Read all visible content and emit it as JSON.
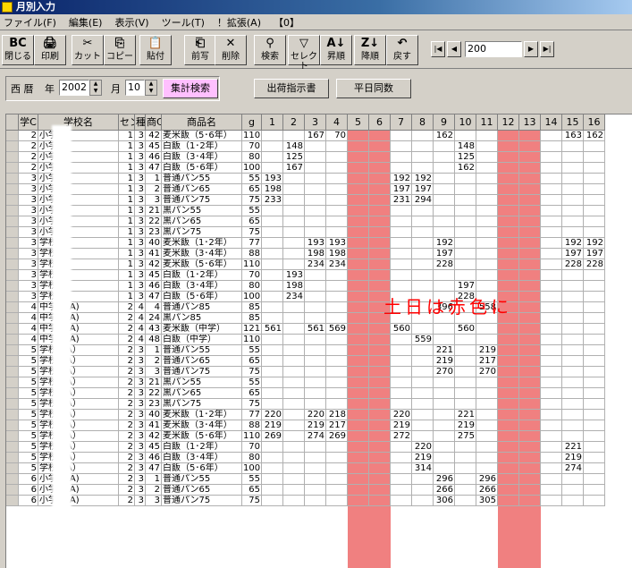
{
  "window": {
    "title": "月別入力"
  },
  "menu": [
    "ファイル(F)",
    "編集(E)",
    "表示(V)",
    "ツール(T)",
    "！拡張(A)",
    "【0】"
  ],
  "toolbar": {
    "buttons": [
      {
        "label": "閉じる",
        "icon": "close-app-icon",
        "glyph": "BC"
      },
      {
        "label": "印刷",
        "icon": "print-icon",
        "glyph": "🖨"
      },
      {
        "label": "カット",
        "icon": "cut-icon",
        "glyph": "✂"
      },
      {
        "label": "コピー",
        "icon": "copy-icon",
        "glyph": "⎘"
      },
      {
        "label": "貼付",
        "icon": "paste-icon",
        "glyph": "📋"
      },
      {
        "label": "前写",
        "icon": "copy-previous-icon",
        "glyph": "⎗"
      },
      {
        "label": "削除",
        "icon": "delete-icon",
        "glyph": "✕"
      },
      {
        "label": "検索",
        "icon": "binoculars-icon",
        "glyph": "⚲"
      },
      {
        "label": "セレクト",
        "icon": "filter-icon",
        "glyph": "▽"
      },
      {
        "label": "昇順",
        "icon": "sort-asc-icon",
        "glyph": "A↓"
      },
      {
        "label": "降順",
        "icon": "sort-desc-icon",
        "glyph": "Z↓"
      },
      {
        "label": "戻す",
        "icon": "undo-icon",
        "glyph": "↶"
      }
    ],
    "record_value": "200"
  },
  "filter": {
    "era_label": "西 暦",
    "year_label": "年",
    "year_value": "2002",
    "month_label": "月",
    "month_value": "10",
    "search_button": "集計検索",
    "shipping_button": "出荷指示書",
    "weekday_button": "平日同数"
  },
  "overlay_text": "土日は赤色に",
  "colors": {
    "weekend": "#f08080",
    "search_button_bg": "#ffc0ff",
    "annotation": "#ff0000"
  },
  "grid": {
    "headers": [
      "学C",
      "学校名",
      "センC",
      "種",
      "商C",
      "商品名",
      "g",
      "1",
      "2",
      "3",
      "4",
      "5",
      "6",
      "7",
      "8",
      "9",
      "10",
      "11",
      "12",
      "13",
      "14",
      "15",
      "16"
    ],
    "rows": [
      [
        "2",
        "小学校",
        "1",
        "3",
        "42",
        "麦米飯（5･6年）",
        "110",
        "",
        "",
        "167",
        "70",
        "",
        "",
        "",
        "",
        "162",
        "",
        "",
        "",
        "",
        "",
        "163",
        "162"
      ],
      [
        "2",
        "小学校",
        "1",
        "3",
        "45",
        "白飯（1･2年）",
        "70",
        "",
        "148",
        "",
        "",
        "",
        "",
        "",
        "",
        "",
        "148",
        "",
        "",
        "",
        "",
        "",
        ""
      ],
      [
        "2",
        "小学校",
        "1",
        "3",
        "46",
        "白飯（3･4年）",
        "80",
        "",
        "125",
        "",
        "",
        "",
        "",
        "",
        "",
        "",
        "125",
        "",
        "",
        "",
        "",
        "",
        ""
      ],
      [
        "2",
        "小学校",
        "1",
        "3",
        "47",
        "白飯（5･6年）",
        "100",
        "",
        "167",
        "",
        "",
        "",
        "",
        "",
        "",
        "",
        "162",
        "",
        "",
        "",
        "",
        "",
        ""
      ],
      [
        "3",
        "小学校",
        "1",
        "3",
        "1",
        "普通パン55",
        "55",
        "193",
        "",
        "",
        "",
        "",
        "",
        "192",
        "192",
        "",
        "",
        "",
        "",
        "",
        "",
        "",
        ""
      ],
      [
        "3",
        "小学校",
        "1",
        "3",
        "2",
        "普通パン65",
        "65",
        "198",
        "",
        "",
        "",
        "",
        "",
        "197",
        "197",
        "",
        "",
        "",
        "",
        "",
        "",
        "",
        ""
      ],
      [
        "3",
        "小学校",
        "1",
        "3",
        "3",
        "普通パン75",
        "75",
        "233",
        "",
        "",
        "",
        "",
        "",
        "231",
        "294",
        "",
        "",
        "",
        "",
        "",
        "",
        "",
        ""
      ],
      [
        "3",
        "小学校",
        "1",
        "3",
        "21",
        "黒パン55",
        "55",
        "",
        "",
        "",
        "",
        "",
        "",
        "",
        "",
        "",
        "",
        "",
        "",
        "",
        "",
        "",
        ""
      ],
      [
        "3",
        "小学校",
        "1",
        "3",
        "22",
        "黒パン65",
        "65",
        "",
        "",
        "",
        "",
        "",
        "",
        "",
        "",
        "",
        "",
        "",
        "",
        "",
        "",
        "",
        ""
      ],
      [
        "3",
        "小学校",
        "1",
        "3",
        "23",
        "黒パン75",
        "75",
        "",
        "",
        "",
        "",
        "",
        "",
        "",
        "",
        "",
        "",
        "",
        "",
        "",
        "",
        "",
        ""
      ],
      [
        "3",
        "学校",
        "1",
        "3",
        "40",
        "麦米飯（1･2年）",
        "77",
        "",
        "",
        "193",
        "193",
        "",
        "",
        "",
        "",
        "192",
        "",
        "",
        "",
        "",
        "",
        "192",
        "192"
      ],
      [
        "3",
        "学校",
        "1",
        "3",
        "41",
        "麦米飯（3･4年）",
        "88",
        "",
        "",
        "198",
        "198",
        "",
        "",
        "",
        "",
        "197",
        "",
        "",
        "",
        "",
        "",
        "197",
        "197"
      ],
      [
        "3",
        "学校",
        "1",
        "3",
        "42",
        "麦米飯（5･6年）",
        "110",
        "",
        "",
        "234",
        "234",
        "",
        "",
        "",
        "",
        "228",
        "",
        "",
        "",
        "",
        "",
        "228",
        "228"
      ],
      [
        "3",
        "学校",
        "1",
        "3",
        "45",
        "白飯（1･2年）",
        "70",
        "",
        "193",
        "",
        "",
        "",
        "",
        "",
        "",
        "",
        "",
        "",
        "",
        "",
        "",
        "",
        ""
      ],
      [
        "3",
        "学校",
        "1",
        "3",
        "46",
        "白飯（3･4年）",
        "80",
        "",
        "198",
        "",
        "",
        "",
        "",
        "",
        "",
        "",
        "197",
        "",
        "",
        "",
        "",
        "",
        ""
      ],
      [
        "3",
        "学校",
        "1",
        "3",
        "47",
        "白飯（5･6年）",
        "100",
        "",
        "234",
        "",
        "",
        "",
        "",
        "",
        "",
        "",
        "228",
        "",
        "",
        "",
        "",
        "",
        ""
      ],
      [
        "4",
        "中学校(A)",
        "2",
        "4",
        "4",
        "普通パン85",
        "85",
        "",
        "",
        "",
        "",
        "",
        "",
        "",
        "",
        "396",
        "",
        "558",
        "",
        "",
        "",
        "",
        ""
      ],
      [
        "4",
        "中学校(A)",
        "2",
        "4",
        "24",
        "黒パン85",
        "85",
        "",
        "",
        "",
        "",
        "",
        "",
        "",
        "",
        "",
        "",
        "",
        "",
        "",
        "",
        "",
        ""
      ],
      [
        "4",
        "中学校(A)",
        "2",
        "4",
        "43",
        "麦米飯（中学）",
        "121",
        "561",
        "",
        "561",
        "569",
        "",
        "",
        "560",
        "",
        "",
        "560",
        "",
        "",
        "",
        "",
        "",
        ""
      ],
      [
        "4",
        "中学校(A)",
        "2",
        "4",
        "48",
        "白飯（中学）",
        "110",
        "",
        "",
        "",
        "",
        "",
        "",
        "",
        "559",
        "",
        "",
        "",
        "",
        "",
        "",
        "",
        ""
      ],
      [
        "5",
        "学校（A）",
        "2",
        "3",
        "1",
        "普通パン55",
        "55",
        "",
        "",
        "",
        "",
        "",
        "",
        "",
        "",
        "221",
        "",
        "219",
        "",
        "",
        "",
        "",
        ""
      ],
      [
        "5",
        "学校（A）",
        "2",
        "3",
        "2",
        "普通パン65",
        "65",
        "",
        "",
        "",
        "",
        "",
        "",
        "",
        "",
        "219",
        "",
        "217",
        "",
        "",
        "",
        "",
        ""
      ],
      [
        "5",
        "学校（A）",
        "2",
        "3",
        "3",
        "普通パン75",
        "75",
        "",
        "",
        "",
        "",
        "",
        "",
        "",
        "",
        "270",
        "",
        "270",
        "",
        "",
        "",
        "",
        ""
      ],
      [
        "5",
        "学校（A）",
        "2",
        "3",
        "21",
        "黒パン55",
        "55",
        "",
        "",
        "",
        "",
        "",
        "",
        "",
        "",
        "",
        "",
        "",
        "",
        "",
        "",
        "",
        ""
      ],
      [
        "5",
        "学校（A）",
        "2",
        "3",
        "22",
        "黒パン65",
        "65",
        "",
        "",
        "",
        "",
        "",
        "",
        "",
        "",
        "",
        "",
        "",
        "",
        "",
        "",
        "",
        ""
      ],
      [
        "5",
        "学校（A）",
        "2",
        "3",
        "23",
        "黒パン75",
        "75",
        "",
        "",
        "",
        "",
        "",
        "",
        "",
        "",
        "",
        "",
        "",
        "",
        "",
        "",
        "",
        ""
      ],
      [
        "5",
        "学校（A）",
        "2",
        "3",
        "40",
        "麦米飯（1･2年）",
        "77",
        "220",
        "",
        "220",
        "218",
        "",
        "",
        "220",
        "",
        "",
        "221",
        "",
        "",
        "",
        "",
        "",
        ""
      ],
      [
        "5",
        "学校（A）",
        "2",
        "3",
        "41",
        "麦米飯（3･4年）",
        "88",
        "219",
        "",
        "219",
        "217",
        "",
        "",
        "219",
        "",
        "",
        "219",
        "",
        "",
        "",
        "",
        "",
        ""
      ],
      [
        "5",
        "学校（A）",
        "2",
        "3",
        "42",
        "麦米飯（5･6年）",
        "110",
        "269",
        "",
        "274",
        "269",
        "",
        "",
        "272",
        "",
        "",
        "275",
        "",
        "",
        "",
        "",
        "",
        ""
      ],
      [
        "5",
        "学校（A）",
        "2",
        "3",
        "45",
        "白飯（1･2年）",
        "70",
        "",
        "",
        "",
        "",
        "",
        "",
        "",
        "220",
        "",
        "",
        "",
        "",
        "",
        "",
        "221",
        ""
      ],
      [
        "5",
        "学校（A）",
        "2",
        "3",
        "46",
        "白飯（3･4年）",
        "80",
        "",
        "",
        "",
        "",
        "",
        "",
        "",
        "219",
        "",
        "",
        "",
        "",
        "",
        "",
        "219",
        ""
      ],
      [
        "5",
        "学校（A）",
        "2",
        "3",
        "47",
        "白飯（5･6年）",
        "100",
        "",
        "",
        "",
        "",
        "",
        "",
        "",
        "314",
        "",
        "",
        "",
        "",
        "",
        "",
        "274",
        ""
      ],
      [
        "6",
        "小学校(A)",
        "2",
        "3",
        "1",
        "普通パン55",
        "55",
        "",
        "",
        "",
        "",
        "",
        "",
        "",
        "",
        "296",
        "",
        "296",
        "",
        "",
        "",
        "",
        ""
      ],
      [
        "6",
        "小学校(A)",
        "2",
        "3",
        "2",
        "普通パン65",
        "65",
        "",
        "",
        "",
        "",
        "",
        "",
        "",
        "",
        "266",
        "",
        "266",
        "",
        "",
        "",
        "",
        ""
      ],
      [
        "6",
        "小学校(A)",
        "2",
        "3",
        "3",
        "普通パン75",
        "75",
        "",
        "",
        "",
        "",
        "",
        "",
        "",
        "",
        "306",
        "",
        "305",
        "",
        "",
        "",
        "",
        ""
      ]
    ]
  }
}
